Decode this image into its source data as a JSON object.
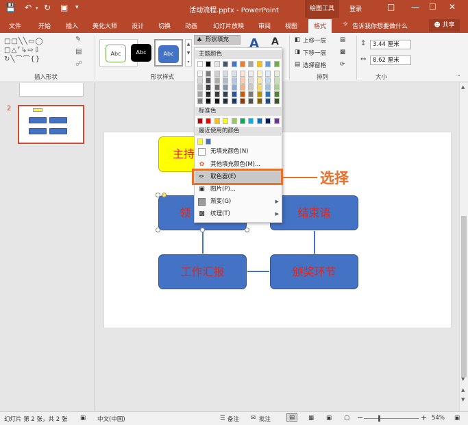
{
  "window": {
    "title": "活动流程.pptx - PowerPoint",
    "context_tools": "绘图工具",
    "login": "登录"
  },
  "tabs": [
    "文件",
    "开始",
    "插入",
    "美化大师",
    "设计",
    "切换",
    "动画",
    "幻灯片放映",
    "审阅",
    "视图",
    "格式"
  ],
  "active_tab": "格式",
  "search_hint": "告诉我你想要做什么",
  "share_label": "共享",
  "ribbon": {
    "groups": {
      "insert_shapes": "插入形状",
      "shape_styles": "形状样式",
      "arrange": "排列",
      "size": "大小"
    },
    "style_samples": [
      "Abc",
      "Abc",
      "Abc"
    ],
    "fill_button": "形状填充",
    "arrange_items": [
      "上移一层",
      "下移一层",
      "选择窗格"
    ],
    "height": "3.44 厘米",
    "width": "8.62 厘米"
  },
  "fill_menu": {
    "theme_colors_title": "主题颜色",
    "standard_colors_title": "标准色",
    "recent_colors_title": "最近使用的颜色",
    "theme_colors": [
      "#ffffff",
      "#000000",
      "#e7e6e6",
      "#44546a",
      "#4472c4",
      "#ed7d31",
      "#a5a5a5",
      "#ffc000",
      "#5b9bd5",
      "#70ad47"
    ],
    "theme_shades": [
      [
        "#f2f2f2",
        "#7f7f7f",
        "#d0cece",
        "#d6dce4",
        "#d9e2f3",
        "#fbe5d5",
        "#ededed",
        "#fff2cc",
        "#deebf6",
        "#e2efd9"
      ],
      [
        "#d8d8d8",
        "#595959",
        "#aeabab",
        "#adb9ca",
        "#b4c6e7",
        "#f7cbac",
        "#dbdbdb",
        "#fee599",
        "#bdd7ee",
        "#c5e0b3"
      ],
      [
        "#bfbfbf",
        "#3f3f3f",
        "#757070",
        "#8496b0",
        "#8eaadb",
        "#f4b183",
        "#c9c9c9",
        "#ffd965",
        "#9cc3e5",
        "#a8d08d"
      ],
      [
        "#a5a5a5",
        "#262626",
        "#3a3838",
        "#323f4f",
        "#2f5496",
        "#c55a11",
        "#7b7b7b",
        "#bf9000",
        "#2e75b5",
        "#538135"
      ],
      [
        "#7f7f7f",
        "#0c0c0c",
        "#171616",
        "#222a35",
        "#1f3864",
        "#833c0b",
        "#525252",
        "#7f6000",
        "#1e4e79",
        "#375623"
      ]
    ],
    "standard_colors": [
      "#c00000",
      "#ff0000",
      "#ffc000",
      "#ffff00",
      "#92d050",
      "#00b050",
      "#00b0f0",
      "#0070c0",
      "#002060",
      "#7030a0"
    ],
    "recent_colors": [
      "#ffff00",
      "#4472c4"
    ],
    "items": {
      "no_fill": "无填充颜色(N)",
      "more_colors": "其他填充颜色(M)...",
      "eyedropper": "取色器(E)",
      "picture": "图片(P)...",
      "gradient": "渐变(G)",
      "texture": "纹理(T)"
    }
  },
  "annotation": "选择",
  "slide": {
    "nodes": [
      "主持",
      "领",
      "结束语",
      "工作汇报",
      "颁奖环节"
    ]
  },
  "thumbnail_number": "2",
  "status": {
    "slide_info": "幻灯片 第 2 张，共 2 张",
    "language": "中文(中国)",
    "notes": "备注",
    "comments": "批注",
    "zoom": "54%"
  },
  "colors": {
    "accent": "#b7472a",
    "node_blue": "#4472c4",
    "node_text": "#e1261c",
    "callout": "#e8702a"
  }
}
